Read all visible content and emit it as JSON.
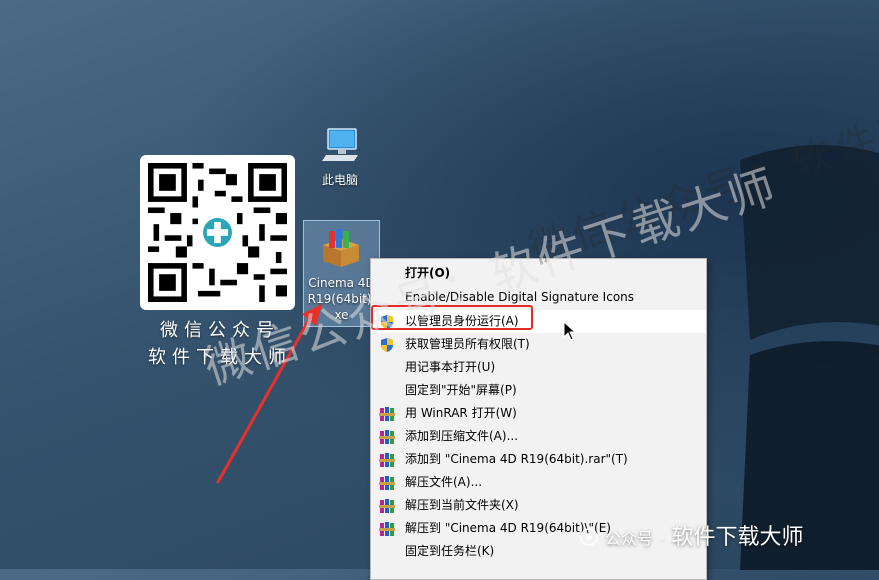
{
  "desktop": {
    "qr_caption_line1": "微信公众号",
    "qr_caption_line2": "软件下载大师",
    "icons": [
      {
        "label": "此电脑"
      },
      {
        "label": "Cinema 4D\nR19(64bit).\nxe"
      }
    ]
  },
  "context_menu": {
    "items": [
      {
        "label": "打开(O)",
        "icon": "none",
        "bold": true
      },
      {
        "label": "Enable/Disable Digital Signature Icons",
        "icon": "none"
      },
      {
        "label": "以管理员身份运行(A)",
        "icon": "uac-shield-icon"
      },
      {
        "label": "获取管理员所有权限(T)",
        "icon": "uac-shield-icon"
      },
      {
        "label": "用记事本打开(U)",
        "icon": "none"
      },
      {
        "label": "固定到\"开始\"屏幕(P)",
        "icon": "none"
      },
      {
        "label": "用 WinRAR 打开(W)",
        "icon": "winrar-icon"
      },
      {
        "label": "添加到压缩文件(A)...",
        "icon": "winrar-icon"
      },
      {
        "label": "添加到 \"Cinema 4D R19(64bit).rar\"(T)",
        "icon": "winrar-icon"
      },
      {
        "label": "解压文件(A)...",
        "icon": "winrar-icon"
      },
      {
        "label": "解压到当前文件夹(X)",
        "icon": "winrar-icon"
      },
      {
        "label": "解压到 \"Cinema 4D R19(64bit)\\\"(E)",
        "icon": "winrar-icon"
      },
      {
        "label": "固定到任务栏(K)",
        "icon": "none"
      }
    ]
  },
  "watermarks": {
    "diagonal_text": "微信公众号：软件下载大师",
    "brand_prefix": "公众号",
    "brand_sep": "·",
    "brand_name": "软件下载大师"
  },
  "colors": {
    "highlight_box": "#e52b26",
    "menu_bg": "#f2f2f2"
  }
}
